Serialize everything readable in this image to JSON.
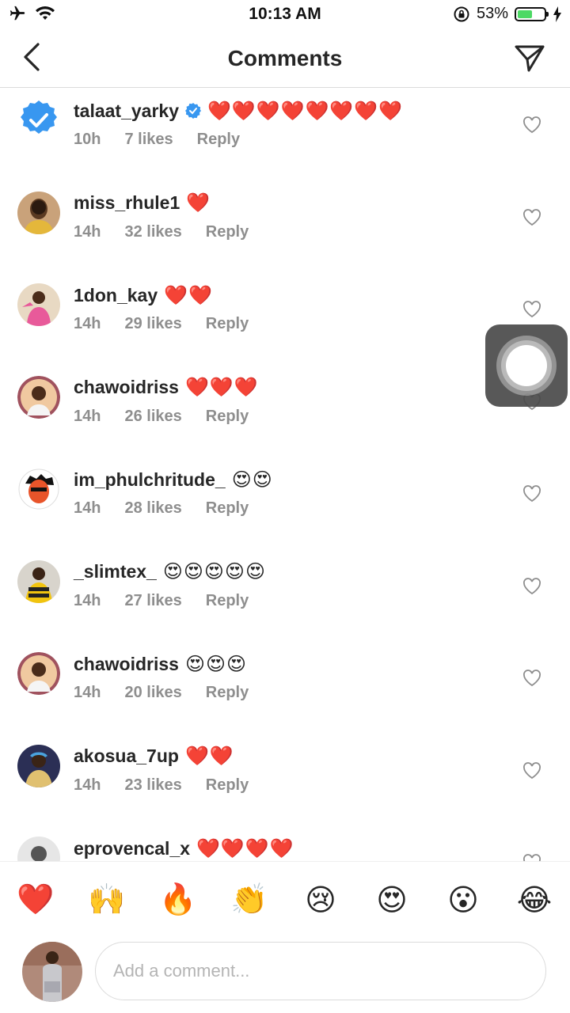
{
  "status_bar": {
    "time": "10:13 AM",
    "battery": "53%"
  },
  "header": {
    "title": "Comments"
  },
  "colors": {
    "verified": "#3897f0",
    "meta": "#8e8e8e",
    "text": "#262626"
  },
  "comments": [
    {
      "username": "talaat_yarky",
      "verified": true,
      "text": "❤️❤️❤️❤️❤️❤️❤️❤️",
      "time": "10h",
      "likes": "7 likes",
      "reply": "Reply"
    },
    {
      "username": "miss_rhule1",
      "verified": false,
      "text": "❤️",
      "time": "14h",
      "likes": "32 likes",
      "reply": "Reply"
    },
    {
      "username": "1don_kay",
      "verified": false,
      "text": "❤️❤️",
      "time": "14h",
      "likes": "29 likes",
      "reply": "Reply"
    },
    {
      "username": "chawoidriss",
      "verified": false,
      "text": "❤️❤️❤️",
      "time": "14h",
      "likes": "26 likes",
      "reply": "Reply"
    },
    {
      "username": "im_phulchritude_",
      "verified": false,
      "text": "😍😍",
      "time": "14h",
      "likes": "28 likes",
      "reply": "Reply"
    },
    {
      "username": "_slimtex_",
      "verified": false,
      "text": "😍😍😍😍😍",
      "time": "14h",
      "likes": "27 likes",
      "reply": "Reply"
    },
    {
      "username": "chawoidriss",
      "verified": false,
      "text": "😍😍😍",
      "time": "14h",
      "likes": "20 likes",
      "reply": "Reply"
    },
    {
      "username": "akosua_7up",
      "verified": false,
      "text": "❤️❤️",
      "time": "14h",
      "likes": "23 likes",
      "reply": "Reply"
    },
    {
      "username": "eprovencal_x",
      "verified": false,
      "text": "❤️❤️❤️❤️",
      "time": "",
      "likes": "",
      "reply": ""
    }
  ],
  "quick_emojis": [
    "❤️",
    "🙌",
    "🔥",
    "👏",
    "😢",
    "😍",
    "😮",
    "😂"
  ],
  "composer": {
    "placeholder": "Add a comment..."
  }
}
